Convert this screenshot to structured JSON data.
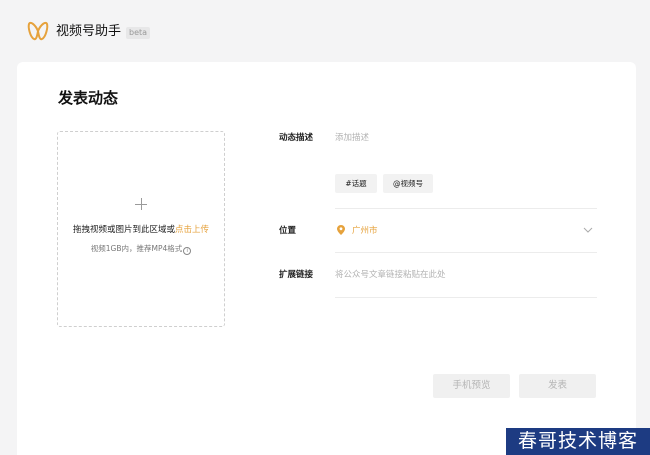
{
  "header": {
    "app_title": "视频号助手",
    "beta_badge": "beta",
    "logo_icon": "butterfly-logo-icon",
    "brand_color": "#e6a23c"
  },
  "page": {
    "title": "发表动态"
  },
  "upload": {
    "icon": "plus-icon",
    "hint_text": "拖拽视频或图片到此区域或",
    "hint_link": "点击上传",
    "sub_text": "视频1GB内，推荐MP4格式",
    "info_icon_glyph": "i"
  },
  "form": {
    "description": {
      "label": "动态描述",
      "placeholder": "添加描述",
      "tags": [
        "#话题",
        "@视频号"
      ]
    },
    "location": {
      "label": "位置",
      "value": "广州市",
      "icon": "location-pin-icon",
      "dropdown_icon": "chevron-down-icon"
    },
    "link": {
      "label": "扩展链接",
      "placeholder": "将公众号文章链接粘贴在此处"
    }
  },
  "actions": {
    "preview_label": "手机预览",
    "publish_label": "发表"
  },
  "watermark": {
    "text": "春哥技术博客"
  }
}
